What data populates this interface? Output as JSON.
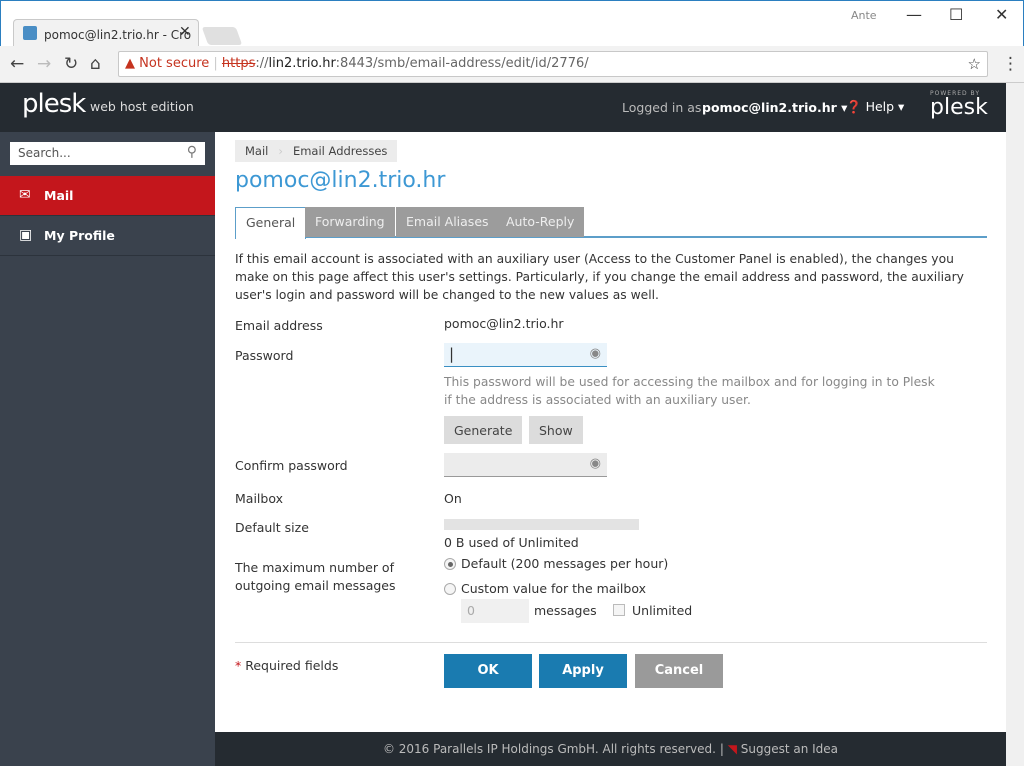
{
  "browser": {
    "tab_title": "pomoc@lin2.trio.hr - Cro",
    "profile": "Ante",
    "security": "Not secure",
    "url_scheme": "https",
    "url_host": "lin2.trio.hr",
    "url_rest": ":8443/smb/email-address/edit/id/2776/"
  },
  "header": {
    "logo": "plesk",
    "edition": "web host edition",
    "logged_in_label": "Logged in as",
    "user": "pomoc@lin2.trio.hr",
    "help": "Help",
    "powered_by": "POWERED BY",
    "powered_logo": "plesk"
  },
  "sidebar": {
    "search_placeholder": "Search...",
    "items": [
      {
        "label": "Mail",
        "active": true
      },
      {
        "label": "My Profile",
        "active": false
      }
    ]
  },
  "breadcrumb": [
    "Mail",
    "Email Addresses"
  ],
  "page_title": "pomoc@lin2.trio.hr",
  "tabs": [
    "General",
    "Forwarding",
    "Email Aliases",
    "Auto-Reply"
  ],
  "intro": "If this email account is associated with an auxiliary user (Access to the Customer Panel is enabled), the changes you make on this page affect this user's settings. Particularly, if you change the email address and password, the auxiliary user's login and password will be changed to the new values as well.",
  "form": {
    "email_label": "Email address",
    "email_value": "pomoc@lin2.trio.hr",
    "password_label": "Password",
    "password_value": "",
    "password_hint": "This password will be used for accessing the mailbox and for logging in to Plesk if the address is associated with an auxiliary user.",
    "generate": "Generate",
    "show": "Show",
    "confirm_label": "Confirm password",
    "mailbox_label": "Mailbox",
    "mailbox_value": "On",
    "size_label": "Default size",
    "size_usage": "0 B used of Unlimited",
    "size_used_fraction": 0,
    "max_label_1": "The maximum number of",
    "max_label_2": "outgoing email messages",
    "opt_default": "Default (200 messages per hour)",
    "opt_custom": "Custom value for the mailbox",
    "custom_value": "0",
    "messages": "messages",
    "unlimited": "Unlimited",
    "required": "Required fields",
    "required_mark": "*",
    "ok": "OK",
    "apply": "Apply",
    "cancel": "Cancel"
  },
  "footer": {
    "copyright": "© 2016 Parallels IP Holdings GmbH. All rights reserved.",
    "separator": "|",
    "suggest": "Suggest an Idea"
  },
  "colors": {
    "accent": "#3d98d4",
    "active_nav": "#c4161c",
    "primary_button": "#1a7bb0"
  }
}
